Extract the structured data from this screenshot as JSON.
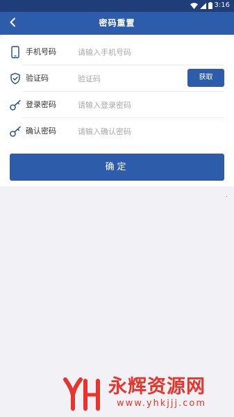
{
  "status_bar": {
    "time": "3:16",
    "icons": [
      "wifi-icon",
      "signal-icon",
      "battery-icon"
    ]
  },
  "app_bar": {
    "title": "密码重置",
    "back_icon": "chevron-left-icon"
  },
  "form": {
    "fields": [
      {
        "icon": "phone-icon",
        "label": "手机号码",
        "placeholder": "请输入手机号码",
        "value": ""
      },
      {
        "icon": "shield-check-icon",
        "label": "验证码",
        "placeholder": "验证码",
        "value": ""
      },
      {
        "icon": "key-icon",
        "label": "登录密码",
        "placeholder": "请输入登录密码",
        "value": ""
      },
      {
        "icon": "key-icon",
        "label": "确认密码",
        "placeholder": "请输入确认密码",
        "value": ""
      }
    ],
    "get_code_label": "获取",
    "confirm_label": "确定"
  },
  "watermark": {
    "name": "永辉资源网",
    "url": "www.yhkjjj.com"
  },
  "colors": {
    "primary": "#2c5caa",
    "status_bar": "#1f3d78",
    "background": "#f2f1f6",
    "icon": "#1f4a8a",
    "watermark": "#e8352b"
  }
}
